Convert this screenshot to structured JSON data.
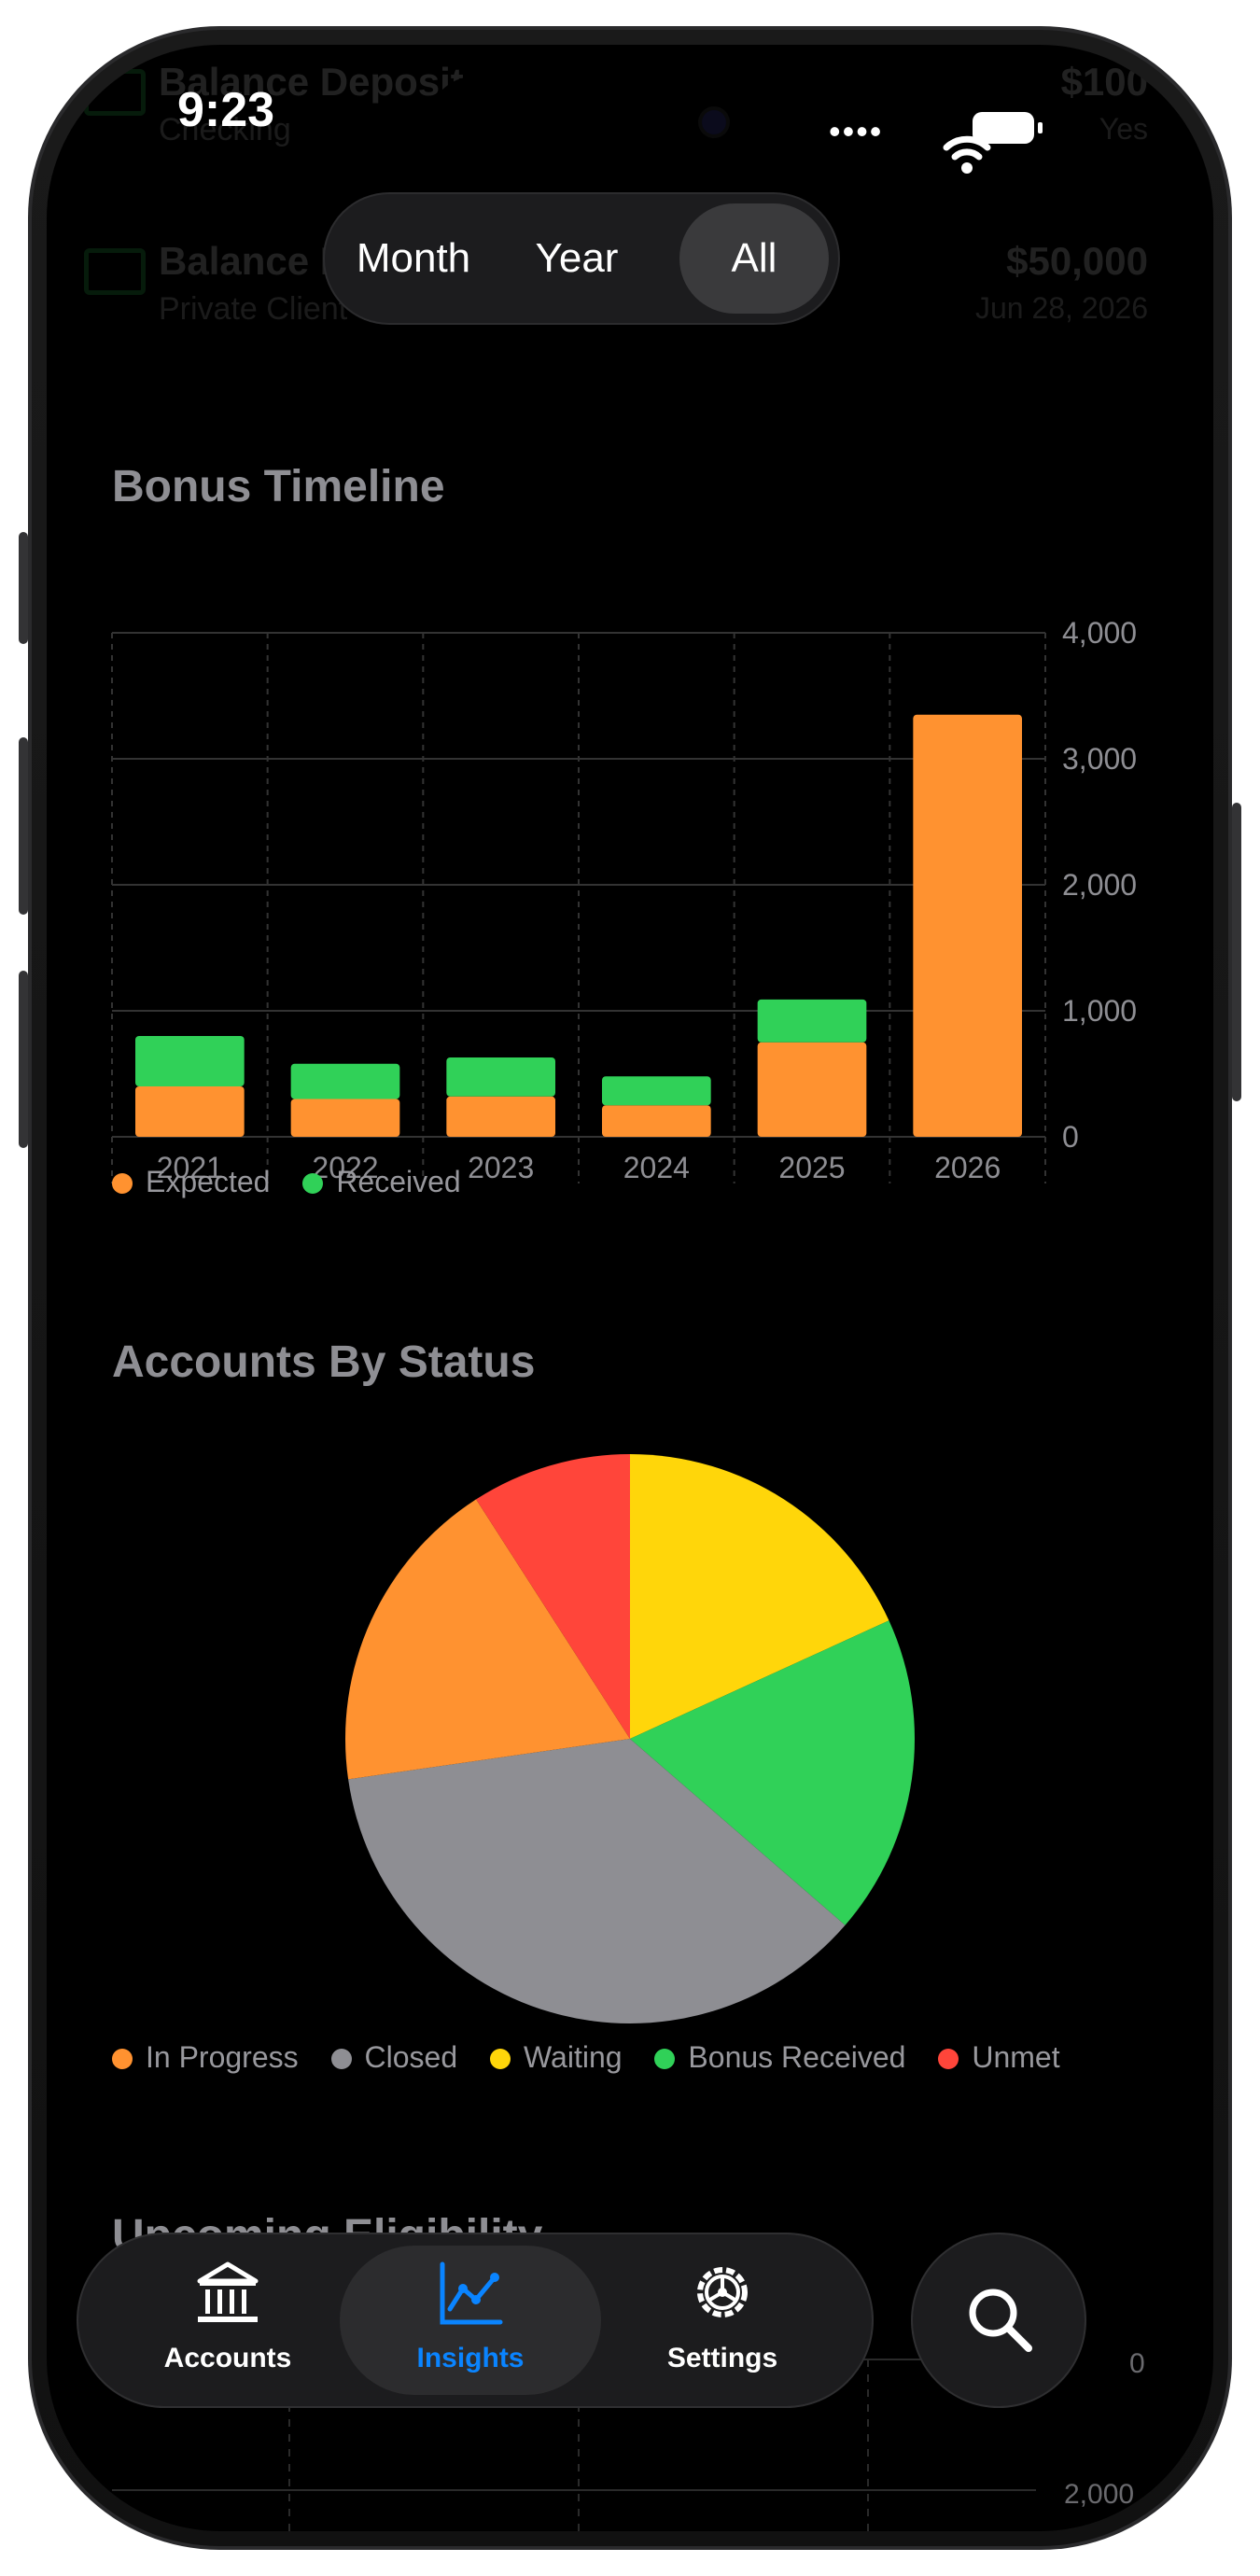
{
  "status_bar": {
    "time": "9:23"
  },
  "background_list": [
    {
      "title": "Balance Deposit",
      "subtitle": "Checking",
      "amount": "$100",
      "date": "Yes"
    },
    {
      "title": "Balance Deposit",
      "subtitle": "Private Client",
      "amount": "$50,000",
      "date": "Jun 28, 2026"
    }
  ],
  "segmented_control": {
    "options": [
      "Month",
      "Year",
      "All"
    ],
    "selected": "All"
  },
  "bonus_timeline": {
    "title": "Bonus Timeline",
    "legend": [
      "Expected",
      "Received"
    ]
  },
  "accounts_by_status": {
    "title": "Accounts By Status",
    "legend": [
      "In Progress",
      "Closed",
      "Waiting",
      "Bonus Received",
      "Unmet"
    ]
  },
  "upcoming_eligibility": {
    "title": "Upcoming Eligibility",
    "visible_tick_labels": [
      "0",
      "2,000"
    ]
  },
  "chart_data": [
    {
      "type": "bar",
      "stacked": true,
      "title": "Bonus Timeline",
      "categories": [
        "2021",
        "2022",
        "2023",
        "2024",
        "2025",
        "2026"
      ],
      "series": [
        {
          "name": "Expected",
          "color": "#ff9230",
          "values": [
            400,
            300,
            320,
            250,
            750,
            3350
          ]
        },
        {
          "name": "Received",
          "color": "#30d158",
          "values": [
            400,
            280,
            310,
            230,
            340,
            0
          ]
        }
      ],
      "ylim": [
        0,
        4000
      ],
      "yticks": [
        "0",
        "1,000",
        "2,000",
        "3,000",
        "4,000"
      ],
      "y_axis_side": "right",
      "grid": true,
      "legend_position": "bottom-left"
    },
    {
      "type": "pie",
      "title": "Accounts By Status",
      "labels": [
        "Waiting",
        "Bonus Received",
        "Closed",
        "In Progress",
        "Unmet"
      ],
      "values": [
        2,
        2,
        4,
        2,
        1
      ],
      "colors": [
        "#ffd60a",
        "#30d158",
        "#8e8e93",
        "#ff9230",
        "#ff453a"
      ],
      "legend_position": "bottom"
    }
  ],
  "tab_bar": {
    "items": [
      {
        "label": "Accounts",
        "icon": "bank-icon"
      },
      {
        "label": "Insights",
        "icon": "chart-line-icon"
      },
      {
        "label": "Settings",
        "icon": "gear-icon"
      }
    ],
    "selected": "Insights",
    "search_icon": "search-icon"
  },
  "colors": {
    "accent": "#0a84ff",
    "background": "#000000"
  }
}
